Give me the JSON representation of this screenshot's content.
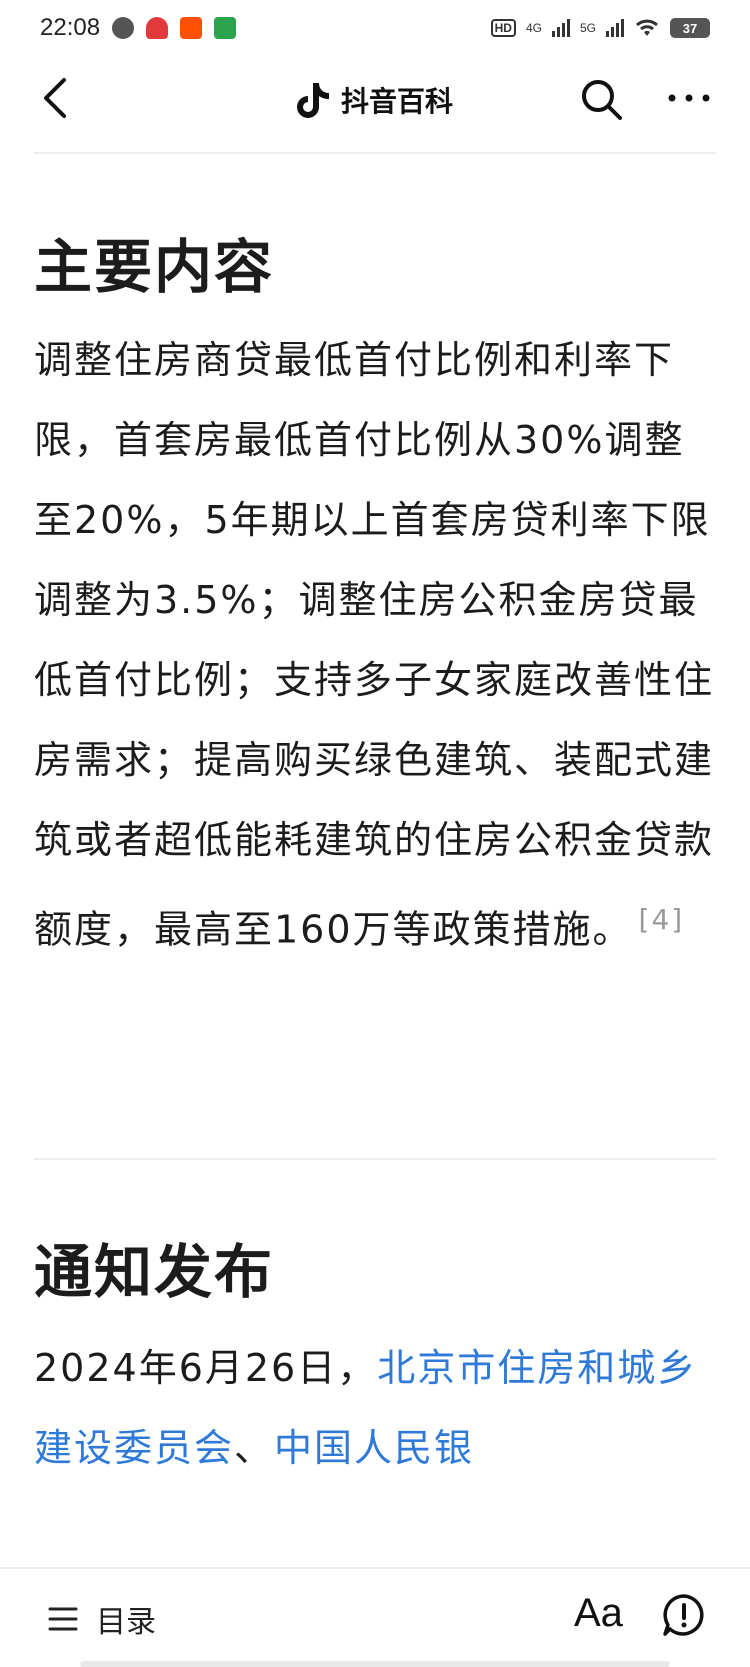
{
  "status_bar": {
    "time": "22:08",
    "network_1": "4G",
    "network_2": "5G",
    "battery": "37",
    "hd_label": "HD"
  },
  "nav": {
    "title": "抖音百科",
    "back_icon": "chevron-left-icon",
    "search_icon": "search-icon",
    "more_icon": "more-icon"
  },
  "sections": [
    {
      "title": "主要内容",
      "paragraph": "调整住房商贷最低首付比例和利率下限，首套房最低首付比例从30%调整至20%，5年期以上首套房贷利率下限调整为3.5%；调整住房公积金房贷最低首付比例；支持多子女家庭改善性住房需求；提高购买绿色建筑、装配式建筑或者超低能耗建筑的住房公积金贷款额度，最高至160万等政策措施。",
      "citation": "[4]"
    },
    {
      "title": "通知发布",
      "lead": "2024年6月26日，",
      "link_1": "北京市住房和城乡建设委员会",
      "separator": "、",
      "link_2": "中国人民银"
    }
  ],
  "bottom_bar": {
    "toc_label": "目录",
    "font_label": "Aa",
    "feedback_icon": "feedback-icon"
  },
  "colors": {
    "link": "#2f7ad8",
    "citation": "#9a9a9a",
    "text": "#1c1c1e"
  }
}
